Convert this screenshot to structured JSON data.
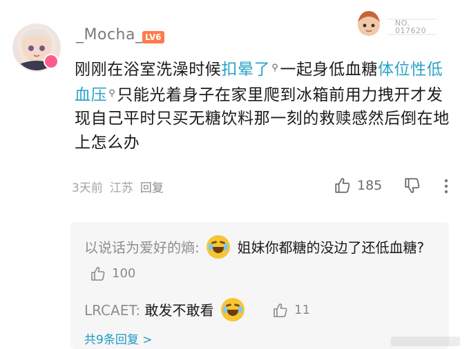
{
  "comment": {
    "username": "_Mocha_",
    "level": "LV6",
    "fan_badge_no": "NO.",
    "fan_badge_number": "017620",
    "text_parts": [
      {
        "t": "刚刚在浴室洗澡时候",
        "kw": false
      },
      {
        "t": "扣晕了",
        "kw": true
      },
      {
        "t": "一起身低血糖",
        "kw": false
      },
      {
        "t": "体位性低血压",
        "kw": true
      },
      {
        "t": "只能光着身子在家里爬到冰箱前用力拽开才发现自己平时只买无糖饮料那一刻的救赎感然后倒在地上怎么办",
        "kw": false
      }
    ],
    "time": "3天前",
    "location": "江苏",
    "reply_label": "回复",
    "like_count": "185"
  },
  "replies": [
    {
      "user": "以说话为爱好的熵:",
      "text": "姐妹你都糖的没边了还低血糖?",
      "likes": "100"
    },
    {
      "user": "LRCAET:",
      "text": "敢发不敢看",
      "likes": "11"
    }
  ],
  "more_replies_label": "共9条回复 >",
  "colors": {
    "keyword": "#2aa3c7",
    "link": "#1e9bc5",
    "level_badge": "#ff7a4a"
  }
}
